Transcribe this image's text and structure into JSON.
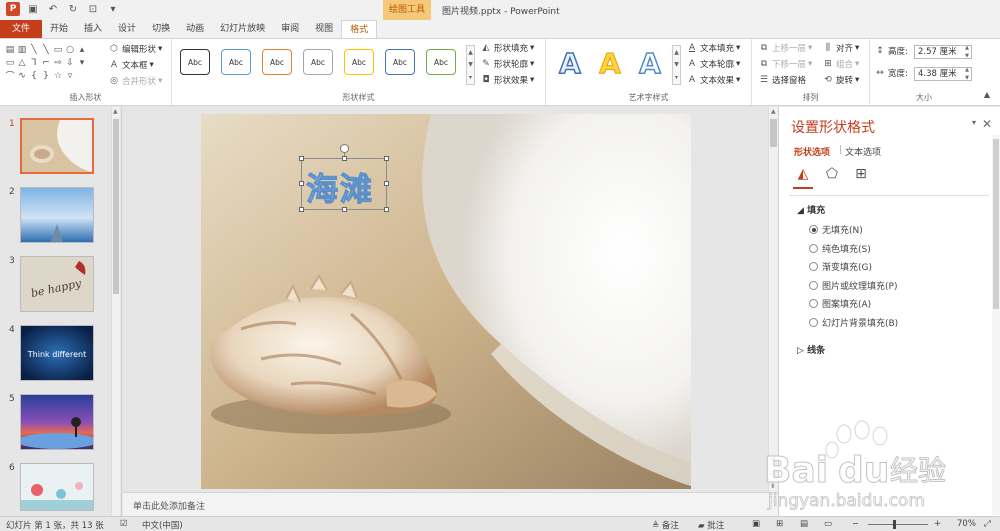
{
  "window": {
    "doc_title": "图片视频.pptx - PowerPoint",
    "context_tab_group": "绘图工具"
  },
  "tabs": [
    "文件",
    "开始",
    "插入",
    "设计",
    "切换",
    "动画",
    "幻灯片放映",
    "审阅",
    "视图",
    "格式"
  ],
  "active_tab": "格式",
  "ribbon": {
    "insert_shapes": {
      "label": "插入形状",
      "edit_shape": "编辑形状",
      "text_box": "文本框",
      "merge_shapes": "合并形状"
    },
    "shape_styles": {
      "label": "形状样式",
      "style_text": "Abc",
      "style_colors": [
        "#333333",
        "#5b9bd5",
        "#ed7d31",
        "#a5a5a5",
        "#ffc000",
        "#4472c4",
        "#70ad47"
      ],
      "shape_fill": "形状填充",
      "shape_outline": "形状轮廓",
      "shape_effects": "形状效果"
    },
    "wordart_styles": {
      "label": "艺术字样式",
      "letter": "A",
      "text_fill": "文本填充",
      "text_outline": "文本轮廓",
      "text_effects": "文本效果"
    },
    "arrange": {
      "label": "排列",
      "bring_forward": "上移一层",
      "send_backward": "下移一层",
      "selection_pane": "选择窗格",
      "align": "对齐",
      "group": "组合",
      "rotate": "旋转"
    },
    "size": {
      "label": "大小",
      "height_label": "高度:",
      "height_value": "2.57 厘米",
      "width_label": "宽度:",
      "width_value": "4.38 厘米"
    }
  },
  "slides": {
    "numbers": [
      "1",
      "2",
      "3",
      "4",
      "5",
      "6"
    ],
    "selected": 1,
    "thumb3_text": "be happy",
    "thumb4_text": "Think different"
  },
  "slide": {
    "text": "海滩"
  },
  "notes_placeholder": "单击此处添加备注",
  "format_pane": {
    "title": "设置形状格式",
    "tab_shape_options": "形状选项",
    "tab_text_options": "文本选项",
    "fill_section": "填充",
    "fill_options": [
      "无填充(N)",
      "纯色填充(S)",
      "渐变填充(G)",
      "图片或纹理填充(P)",
      "图案填充(A)",
      "幻灯片背景填充(B)"
    ],
    "selected_fill": 0,
    "line_section": "线条"
  },
  "statusbar": {
    "slide_info": "幻灯片 第 1 张，共 13 张",
    "language": "中文(中国)",
    "notes": "备注",
    "comments": "批注",
    "zoom": "70%"
  },
  "watermark": {
    "brand": "Baidu经验",
    "url": "jingyan.baidu.com"
  }
}
